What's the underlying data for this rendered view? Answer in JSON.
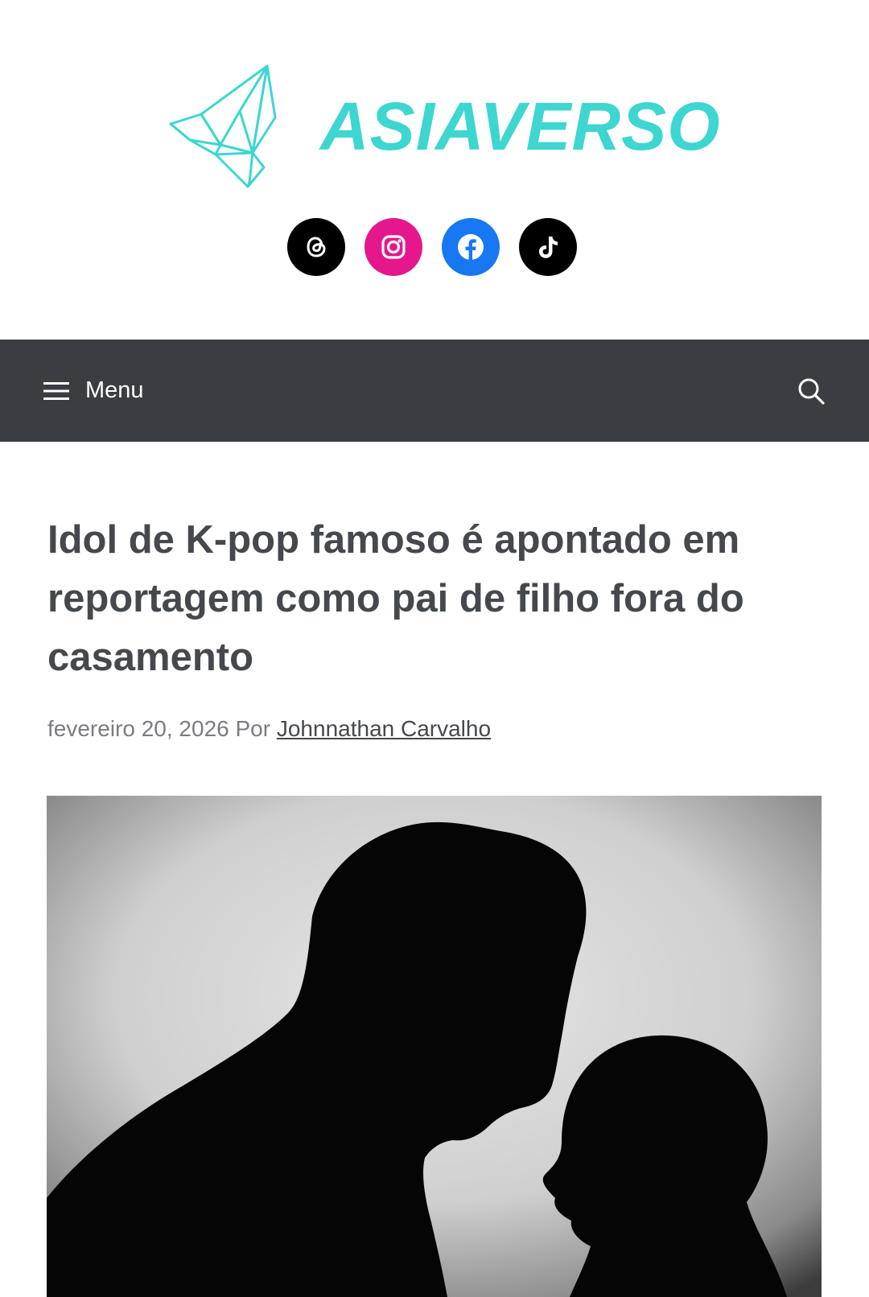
{
  "site": {
    "name": "ASIAVERSO",
    "brand_color": "#3dd6d0"
  },
  "social": [
    {
      "name": "threads",
      "icon": "threads-icon",
      "bg": "#000000"
    },
    {
      "name": "instagram",
      "icon": "instagram-icon",
      "bg": "#e4178c"
    },
    {
      "name": "facebook",
      "icon": "facebook-icon",
      "bg": "#1877f2"
    },
    {
      "name": "tiktok",
      "icon": "tiktok-icon",
      "bg": "#000000"
    }
  ],
  "nav": {
    "menu_label": "Menu",
    "bg_color": "#3a3d42",
    "menu_icon": "hamburger-icon",
    "search_icon": "search-icon"
  },
  "article": {
    "title": "Idol de K-pop famoso é apontado em reportagem como pai de filho fora do casamento",
    "date": "fevereiro 20, 2026",
    "by_label": "Por",
    "author": "Johnnathan Carvalho"
  }
}
